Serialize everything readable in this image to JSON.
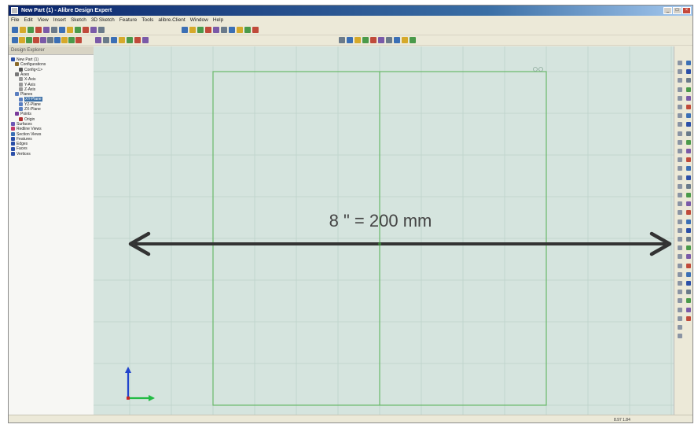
{
  "window": {
    "title": "New Part (1) - Alibre Design Expert",
    "controls": [
      "_",
      "□",
      "×"
    ]
  },
  "menu": [
    "File",
    "Edit",
    "View",
    "Insert",
    "Sketch",
    "3D Sketch",
    "Feature",
    "Tools",
    "alibre.Client",
    "Window",
    "Help"
  ],
  "design_explorer": {
    "header": "Design Explorer",
    "items": [
      {
        "label": "New Part (1)",
        "icon": "part-icon",
        "color": "#2b4fa8",
        "selected": false
      },
      {
        "label": "Configurations",
        "icon": "configurations-icon",
        "color": "#8a6a2a",
        "selected": false
      },
      {
        "label": "Config<1>",
        "icon": "config-icon",
        "color": "#555555",
        "selected": false
      },
      {
        "label": "Axes",
        "icon": "axes-icon",
        "color": "#777777",
        "selected": false
      },
      {
        "label": "X-Axis",
        "icon": "axis-icon",
        "color": "#999999",
        "selected": false
      },
      {
        "label": "Y-Axis",
        "icon": "axis-icon",
        "color": "#999999",
        "selected": false
      },
      {
        "label": "Z-Axis",
        "icon": "axis-icon",
        "color": "#999999",
        "selected": false
      },
      {
        "label": "Planes",
        "icon": "planes-icon",
        "color": "#5a7fc0",
        "selected": false
      },
      {
        "label": "XY-Plane",
        "icon": "plane-icon",
        "color": "#5a7fc0",
        "selected": true
      },
      {
        "label": "YZ-Plane",
        "icon": "plane-icon",
        "color": "#5a7fc0",
        "selected": false
      },
      {
        "label": "ZX-Plane",
        "icon": "plane-icon",
        "color": "#5a7fc0",
        "selected": false
      },
      {
        "label": "Points",
        "icon": "points-icon",
        "color": "#7a3b9b",
        "selected": false
      },
      {
        "label": "Origin",
        "icon": "origin-icon",
        "color": "#b03030",
        "selected": false
      },
      {
        "label": "Surfaces",
        "icon": "surfaces-icon",
        "color": "#6d57b5",
        "selected": false
      },
      {
        "label": "Redline Views",
        "icon": "redline-icon",
        "color": "#c03a6a",
        "selected": false
      },
      {
        "label": "Section Views",
        "icon": "section-icon",
        "color": "#3b6fb5",
        "selected": false
      },
      {
        "label": "Features",
        "icon": "features-icon",
        "color": "#2b4fa8",
        "selected": false
      },
      {
        "label": "Edges",
        "icon": "edges-icon",
        "color": "#2b4fa8",
        "selected": false
      },
      {
        "label": "Faces",
        "icon": "faces-icon",
        "color": "#2b4fa8",
        "selected": false
      },
      {
        "label": "Vertices",
        "icon": "vertices-icon",
        "color": "#2b4fa8",
        "selected": false
      }
    ]
  },
  "annotation": {
    "text": "8 \" = 200 mm"
  },
  "colors": {
    "viewport_bg": "#d5e4de",
    "grid": "#bcd2ca",
    "sketch_line": "#6ab86a",
    "arrow": "#333333",
    "axis_y": "#2244cc",
    "axis_x": "#22bb44",
    "axis_z": "#cc2222"
  },
  "status": {
    "coords": "8.97 1.84"
  }
}
